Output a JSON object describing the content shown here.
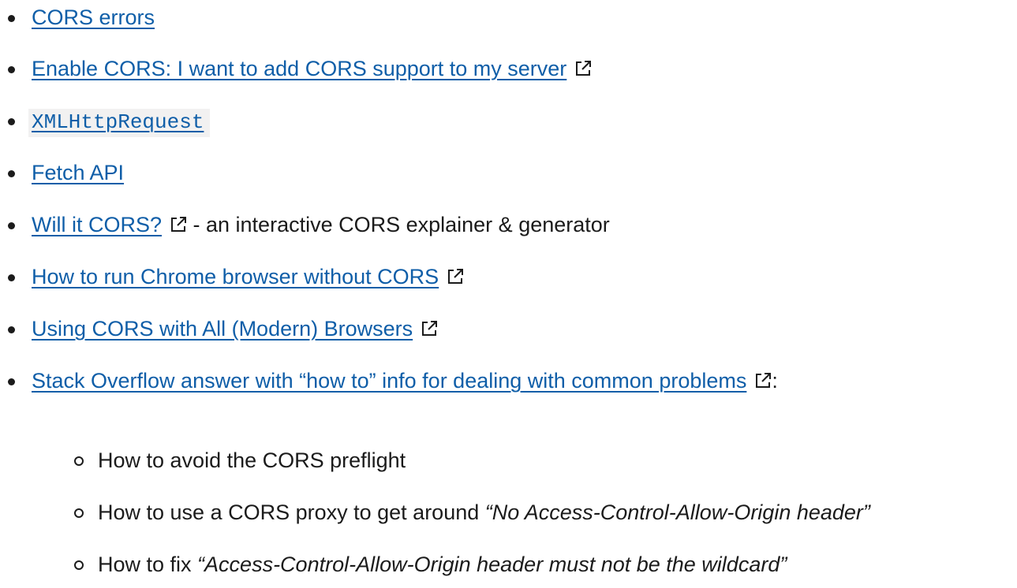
{
  "items": [
    {
      "link": "CORS errors"
    },
    {
      "link": "Enable CORS: I want to add CORS support to my server",
      "external_icon": "external-link-icon"
    },
    {
      "code_link": "XMLHttpRequest"
    },
    {
      "link": "Fetch API"
    },
    {
      "link": "Will it CORS?",
      "external_icon": "external-link-icon",
      "suffix": " - an interactive CORS explainer & generator"
    },
    {
      "link": "How to run Chrome browser without CORS",
      "external_icon": "external-link-icon"
    },
    {
      "link": "Using CORS with All (Modern) Browsers",
      "external_icon": "external-link-icon"
    },
    {
      "link": "Stack Overflow answer with “how to” info for dealing with common problems",
      "external_icon": "external-link-icon",
      "suffix": ":"
    }
  ],
  "sub_items": [
    {
      "text": "How to avoid the CORS preflight"
    },
    {
      "text": "How to use a CORS proxy to get around ",
      "emphasis": "“No Access-Control-Allow-Origin header”"
    },
    {
      "text": "How to fix ",
      "emphasis": "“Access-Control-Allow-Origin header must not be the wildcard”"
    }
  ],
  "colors": {
    "link": "#0f5ea8",
    "text": "#1b1b1b",
    "code_background": "#f2f1f1"
  }
}
